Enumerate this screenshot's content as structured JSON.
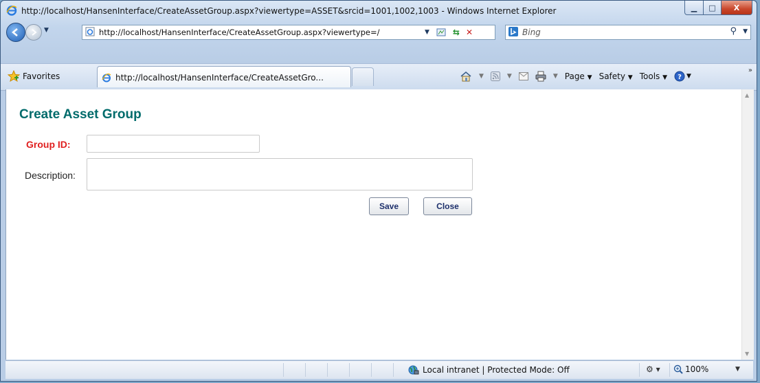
{
  "window": {
    "title": "http://localhost/HansenInterface/CreateAssetGroup.aspx?viewertype=ASSET&srcid=1001,1002,1003 - Windows Internet Explorer",
    "minimize": "▁",
    "maximize": "□",
    "close": "X"
  },
  "nav": {
    "address": "http://localhost/HansenInterface/CreateAssetGroup.aspx?viewertype=/",
    "search_placeholder": "Bing"
  },
  "favorites": {
    "label": "Favorites",
    "tab_title": "http://localhost/HansenInterface/CreateAssetGro..."
  },
  "commandbar": {
    "page": "Page",
    "safety": "Safety",
    "tools": "Tools"
  },
  "page": {
    "title": "Create Asset Group",
    "group_id_label": "Group ID:",
    "group_id_value": "",
    "description_label": "Description:",
    "description_value": "",
    "save_label": "Save",
    "close_label": "Close"
  },
  "status": {
    "zone": "Local intranet | Protected Mode: Off",
    "zoom": "100%"
  },
  "colors": {
    "title": "#006b6b",
    "required_label": "#e02020",
    "button_text": "#1d2f6b"
  }
}
